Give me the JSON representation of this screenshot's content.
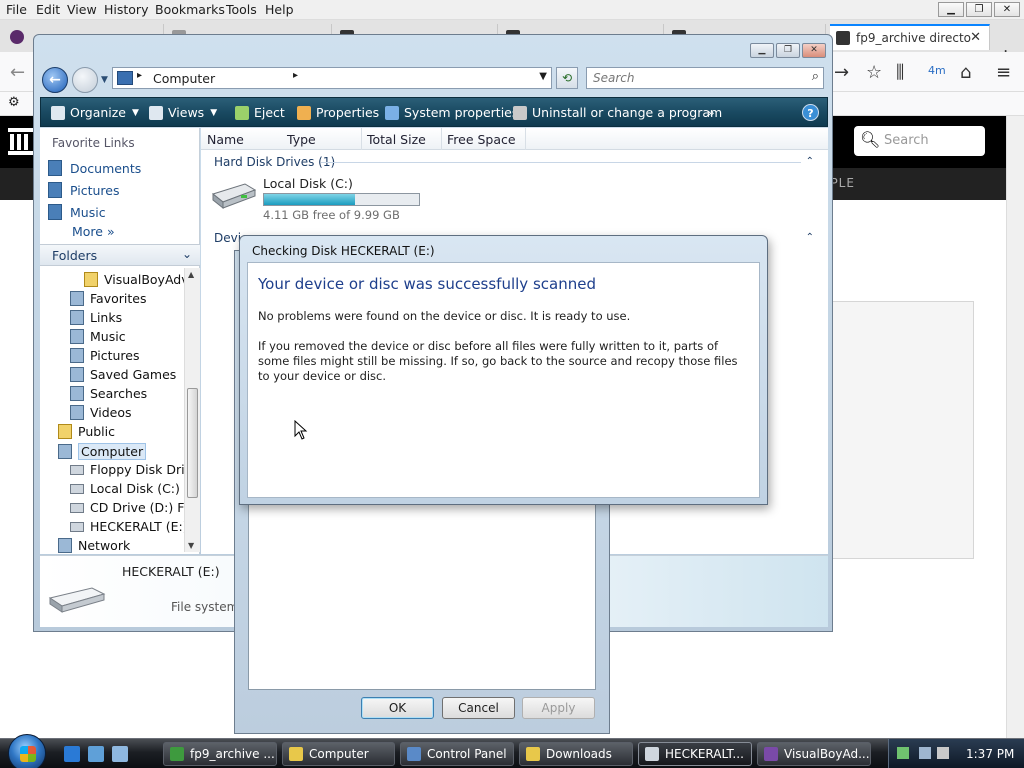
{
  "firefox": {
    "menu": [
      "File",
      "Edit",
      "View",
      "History",
      "Bookmarks",
      "Tools",
      "Help"
    ],
    "active_tab_title": "fp9_archive directo",
    "site_search_placeholder": "Search",
    "site_nav_fragment": "OPLE"
  },
  "explorer": {
    "address_crumb": "Computer",
    "search_placeholder": "Search",
    "toolbar": {
      "organize": "Organize",
      "views": "Views",
      "eject": "Eject",
      "properties": "Properties",
      "system_properties": "System properties",
      "uninstall": "Uninstall or change a program",
      "overflow": "»",
      "help": "?"
    },
    "nav": {
      "favorite_links_heading": "Favorite Links",
      "favorite_links": [
        "Documents",
        "Pictures",
        "Music"
      ],
      "more": "More",
      "folders_heading": "Folders",
      "tree": [
        {
          "label": "VisualBoyAdva",
          "kind": "yellow"
        },
        {
          "label": "Favorites",
          "kind": "blue"
        },
        {
          "label": "Links",
          "kind": "blue"
        },
        {
          "label": "Music",
          "kind": "blue"
        },
        {
          "label": "Pictures",
          "kind": "blue"
        },
        {
          "label": "Saved Games",
          "kind": "blue"
        },
        {
          "label": "Searches",
          "kind": "blue"
        },
        {
          "label": "Videos",
          "kind": "blue"
        },
        {
          "label": "Public",
          "kind": "yellow"
        },
        {
          "label": "Computer",
          "kind": "blue"
        },
        {
          "label": "Floppy Disk Drive",
          "kind": "drive"
        },
        {
          "label": "Local Disk (C:)",
          "kind": "drive"
        },
        {
          "label": "CD Drive (D:) FG.",
          "kind": "drive"
        },
        {
          "label": "HECKERALT (E:)",
          "kind": "drive"
        },
        {
          "label": "Network",
          "kind": "blue"
        }
      ]
    },
    "columns": [
      "Name",
      "Type",
      "Total Size",
      "Free Space"
    ],
    "groups": {
      "hard_disk": "Hard Disk Drives (1)",
      "removable_fragment": "Devic"
    },
    "local_disk": {
      "name": "Local Disk (C:)",
      "free_text": "4.11 GB free of 9.99 GB",
      "used_fraction": 0.59
    },
    "details": {
      "name": "HECKERALT (E:)",
      "file_system_label": "File system:"
    }
  },
  "properties_dialog": {
    "ok": "OK",
    "cancel": "Cancel",
    "apply": "Apply"
  },
  "check_dialog": {
    "title": "Checking Disk HECKERALT (E:)",
    "heading": "Your device or disc was successfully scanned",
    "paragraph1": "No problems were found on the device or disc. It is ready to use.",
    "paragraph2": "If you removed the device or disc before all files were fully written to it, parts of some files might still be missing. If so, go back to the source and recopy those files to your device or disc."
  },
  "taskbar": {
    "tasks": [
      {
        "label": "fp9_archive ...",
        "color": "#3e9a3e"
      },
      {
        "label": "Computer",
        "color": "#e8c84a"
      },
      {
        "label": "Control Panel",
        "color": "#5a8ac8"
      },
      {
        "label": "Downloads",
        "color": "#e8c84a"
      },
      {
        "label": "HECKERALT...",
        "color": "#cfd6de"
      },
      {
        "label": "VisualBoyAd...",
        "color": "#7a4aa8"
      }
    ],
    "clock": "1:37 PM"
  }
}
